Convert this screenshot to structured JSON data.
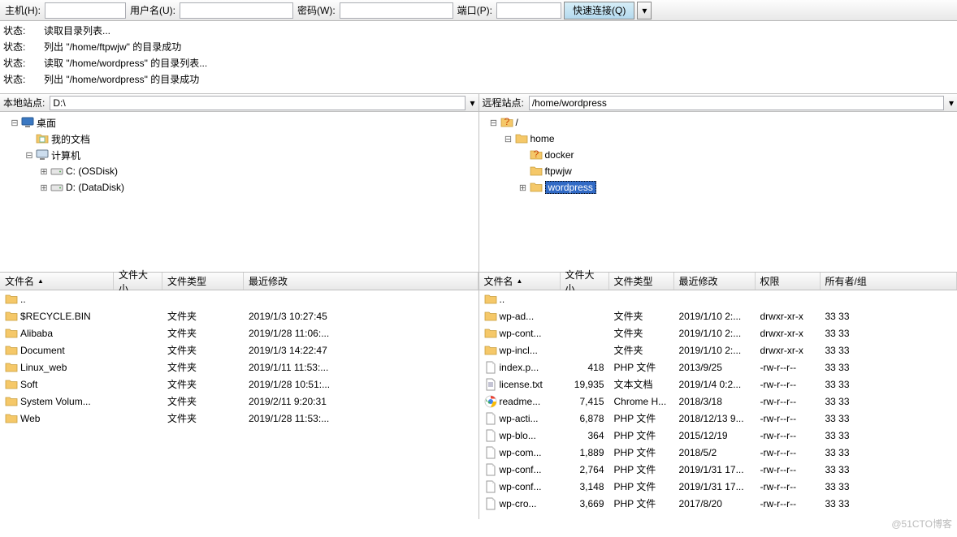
{
  "toolbar": {
    "host_label": "主机(H):",
    "user_label": "用户名(U):",
    "pass_label": "密码(W):",
    "port_label": "端口(P):",
    "connect_label": "快速连接(Q)"
  },
  "log": [
    {
      "label": "状态:",
      "msg": "读取目录列表..."
    },
    {
      "label": "状态:",
      "msg": "列出 \"/home/ftpwjw\" 的目录成功"
    },
    {
      "label": "状态:",
      "msg": "读取 \"/home/wordpress\" 的目录列表..."
    },
    {
      "label": "状态:",
      "msg": "列出 \"/home/wordpress\" 的目录成功"
    }
  ],
  "local": {
    "site_label": "本地站点:",
    "site_value": "D:\\",
    "tree": [
      {
        "indent": 0,
        "tw": "⊟",
        "icon": "desktop",
        "label": "桌面"
      },
      {
        "indent": 1,
        "tw": "",
        "icon": "folder-doc",
        "label": "我的文档"
      },
      {
        "indent": 1,
        "tw": "⊟",
        "icon": "computer",
        "label": "计算机"
      },
      {
        "indent": 2,
        "tw": "⊞",
        "icon": "drive",
        "label": "C: (OSDisk)"
      },
      {
        "indent": 2,
        "tw": "⊞",
        "icon": "drive",
        "label": "D: (DataDisk)"
      }
    ],
    "cols": {
      "name": "文件名",
      "size": "文件大小",
      "type": "文件类型",
      "modified": "最近修改"
    },
    "files": [
      {
        "icon": "folder",
        "name": "..",
        "size": "",
        "type": "",
        "modified": ""
      },
      {
        "icon": "folder",
        "name": "$RECYCLE.BIN",
        "size": "",
        "type": "文件夹",
        "modified": "2019/1/3 10:27:45"
      },
      {
        "icon": "folder",
        "name": "Alibaba",
        "size": "",
        "type": "文件夹",
        "modified": "2019/1/28 11:06:..."
      },
      {
        "icon": "folder",
        "name": "Document",
        "size": "",
        "type": "文件夹",
        "modified": "2019/1/3 14:22:47"
      },
      {
        "icon": "folder",
        "name": "Linux_web",
        "size": "",
        "type": "文件夹",
        "modified": "2019/1/11 11:53:..."
      },
      {
        "icon": "folder",
        "name": "Soft",
        "size": "",
        "type": "文件夹",
        "modified": "2019/1/28 10:51:..."
      },
      {
        "icon": "folder",
        "name": "System Volum...",
        "size": "",
        "type": "文件夹",
        "modified": "2019/2/11 9:20:31"
      },
      {
        "icon": "folder",
        "name": "Web",
        "size": "",
        "type": "文件夹",
        "modified": "2019/1/28 11:53:..."
      }
    ]
  },
  "remote": {
    "site_label": "远程站点:",
    "site_value": "/home/wordpress",
    "tree": [
      {
        "indent": 0,
        "tw": "⊟",
        "icon": "unk",
        "label": "/"
      },
      {
        "indent": 1,
        "tw": "⊟",
        "icon": "folder",
        "label": "home"
      },
      {
        "indent": 2,
        "tw": "",
        "icon": "unk",
        "label": "docker"
      },
      {
        "indent": 2,
        "tw": "",
        "icon": "folder",
        "label": "ftpwjw"
      },
      {
        "indent": 2,
        "tw": "⊞",
        "icon": "folder",
        "label": "wordpress",
        "sel": true
      }
    ],
    "cols": {
      "name": "文件名",
      "size": "文件大小",
      "type": "文件类型",
      "modified": "最近修改",
      "perm": "权限",
      "owner": "所有者/组"
    },
    "files": [
      {
        "icon": "folder",
        "name": "..",
        "size": "",
        "type": "",
        "modified": "",
        "perm": "",
        "owner": ""
      },
      {
        "icon": "folder",
        "name": "wp-ad...",
        "size": "",
        "type": "文件夹",
        "modified": "2019/1/10 2:...",
        "perm": "drwxr-xr-x",
        "owner": "33 33"
      },
      {
        "icon": "folder",
        "name": "wp-cont...",
        "size": "",
        "type": "文件夹",
        "modified": "2019/1/10 2:...",
        "perm": "drwxr-xr-x",
        "owner": "33 33"
      },
      {
        "icon": "folder",
        "name": "wp-incl...",
        "size": "",
        "type": "文件夹",
        "modified": "2019/1/10 2:...",
        "perm": "drwxr-xr-x",
        "owner": "33 33"
      },
      {
        "icon": "file",
        "name": "index.p...",
        "size": "418",
        "type": "PHP 文件",
        "modified": "2013/9/25",
        "perm": "-rw-r--r--",
        "owner": "33 33"
      },
      {
        "icon": "text",
        "name": "license.txt",
        "size": "19,935",
        "type": "文本文档",
        "modified": "2019/1/4 0:2...",
        "perm": "-rw-r--r--",
        "owner": "33 33"
      },
      {
        "icon": "chrome",
        "name": "readme...",
        "size": "7,415",
        "type": "Chrome H...",
        "modified": "2018/3/18",
        "perm": "-rw-r--r--",
        "owner": "33 33"
      },
      {
        "icon": "file",
        "name": "wp-acti...",
        "size": "6,878",
        "type": "PHP 文件",
        "modified": "2018/12/13 9...",
        "perm": "-rw-r--r--",
        "owner": "33 33"
      },
      {
        "icon": "file",
        "name": "wp-blo...",
        "size": "364",
        "type": "PHP 文件",
        "modified": "2015/12/19",
        "perm": "-rw-r--r--",
        "owner": "33 33"
      },
      {
        "icon": "file",
        "name": "wp-com...",
        "size": "1,889",
        "type": "PHP 文件",
        "modified": "2018/5/2",
        "perm": "-rw-r--r--",
        "owner": "33 33"
      },
      {
        "icon": "file",
        "name": "wp-conf...",
        "size": "2,764",
        "type": "PHP 文件",
        "modified": "2019/1/31 17...",
        "perm": "-rw-r--r--",
        "owner": "33 33"
      },
      {
        "icon": "file",
        "name": "wp-conf...",
        "size": "3,148",
        "type": "PHP 文件",
        "modified": "2019/1/31 17...",
        "perm": "-rw-r--r--",
        "owner": "33 33"
      },
      {
        "icon": "file",
        "name": "wp-cro...",
        "size": "3,669",
        "type": "PHP 文件",
        "modified": "2017/8/20",
        "perm": "-rw-r--r--",
        "owner": "33 33"
      }
    ]
  },
  "watermark": "@51CTO博客"
}
